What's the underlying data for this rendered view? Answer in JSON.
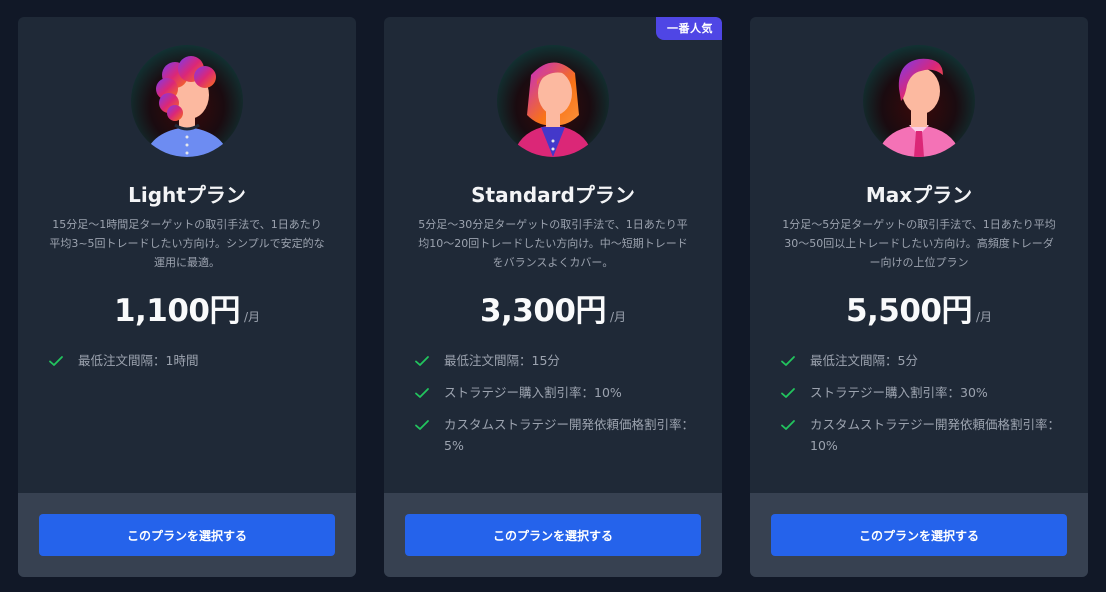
{
  "plans": [
    {
      "name": "Lightプラン",
      "description": "15分足〜1時間足ターゲットの取引手法で、1日あたり平均3~5回トレードしたい方向け。シンプルで安定的な運用に最適。",
      "price": "1,100円",
      "unit": "/月",
      "features": [
        "最低注文間隔：1時間"
      ],
      "button_label": "このプランを選択する",
      "avatar_icon": "person-curly-hair-icon"
    },
    {
      "name": "Standardプラン",
      "description": "5分足〜30分足ターゲットの取引手法で、1日あたり平均10〜20回トレードしたい方向け。中〜短期トレードをバランスよくカバー。",
      "price": "3,300円",
      "unit": "/月",
      "badge": "一番人気",
      "features": [
        "最低注文間隔：15分",
        "ストラテジー購入割引率：10%",
        "カスタムストラテジー開発依頼価格割引率：5%"
      ],
      "button_label": "このプランを選択する",
      "avatar_icon": "person-long-hair-icon"
    },
    {
      "name": "Maxプラン",
      "description": "1分足〜5分足ターゲットの取引手法で、1日あたり平均30〜50回以上トレードしたい方向け。高頻度トレーダー向けの上位プラン",
      "price": "5,500円",
      "unit": "/月",
      "features": [
        "最低注文間隔：5分",
        "ストラテジー購入割引率：30%",
        "カスタムストラテジー開発依頼価格割引率：10%"
      ],
      "button_label": "このプランを選択する",
      "avatar_icon": "person-with-tie-icon"
    }
  ],
  "colors": {
    "background": "#111827",
    "card": "#1f2937",
    "card_footer": "#374151",
    "button": "#2563eb",
    "check": "#22c55e",
    "badge": "#4f46e5"
  }
}
